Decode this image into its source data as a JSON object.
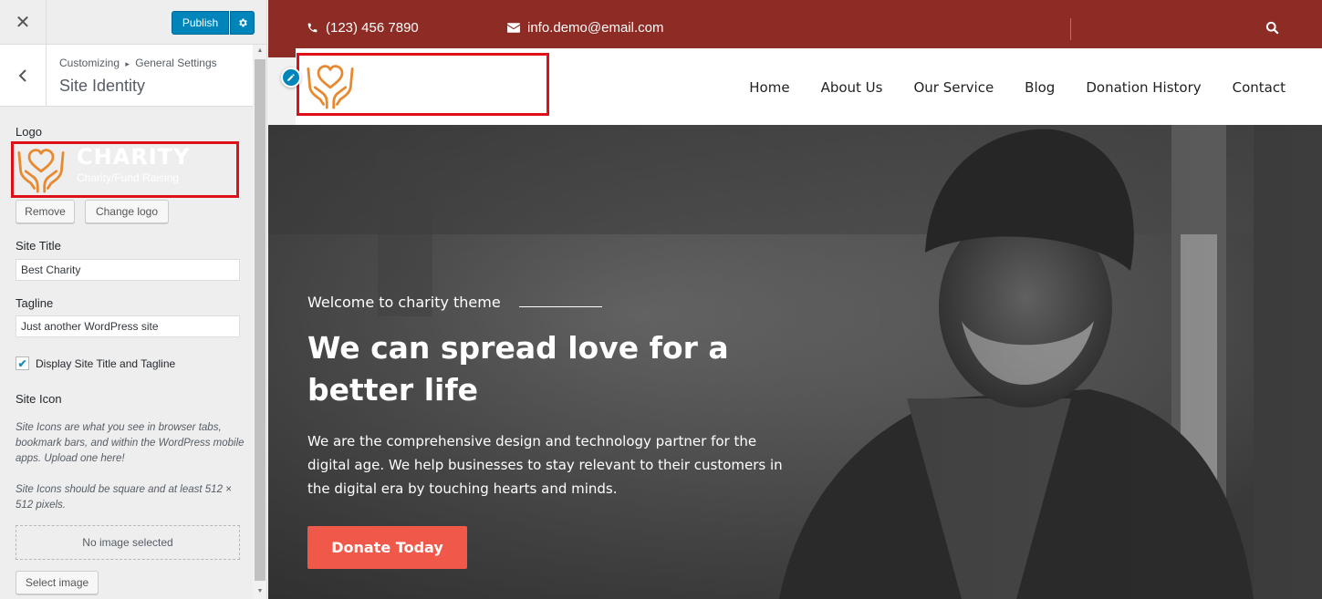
{
  "customizer": {
    "close_icon": "close-icon",
    "publish_label": "Publish",
    "breadcrumb_root": "Customizing",
    "breadcrumb_sep": "▸",
    "breadcrumb_section": "General Settings",
    "section_title": "Site Identity",
    "logo_label": "Logo",
    "logo_name": "CHARITY",
    "logo_tagline": "Charity/Fund Raising",
    "remove_label": "Remove",
    "change_logo_label": "Change logo",
    "site_title_label": "Site Title",
    "site_title_value": "Best Charity",
    "tagline_label": "Tagline",
    "tagline_value": "Just another WordPress site",
    "display_checkbox_label": "Display Site Title and Tagline",
    "display_checkbox_checked": true,
    "site_icon_label": "Site Icon",
    "site_icon_desc_1": "Site Icons are what you see in browser tabs, bookmark bars, and within the WordPress mobile apps. Upload one here!",
    "site_icon_desc_2": "Site Icons should be square and at least 512 × 512 pixels.",
    "no_image_label": "No image selected",
    "select_image_label": "Select image"
  },
  "preview": {
    "phone": "(123) 456 7890",
    "email": "info.demo@email.com",
    "nav": [
      "Home",
      "About Us",
      "Our Service",
      "Blog",
      "Donation History",
      "Contact"
    ],
    "hero_kicker": "Welcome to charity theme",
    "hero_heading": "We can spread love for a better life",
    "hero_text": "We are the comprehensive design and technology partner for the digital age. We help businesses to stay relevant to their customers in the digital era by touching hearts and minds.",
    "donate_label": "Donate Today"
  },
  "colors": {
    "accent_blue": "#0085ba",
    "topbar_red": "#8c2c24",
    "donate_orange": "#f0594a",
    "highlight_red": "#e0101a",
    "logo_orange": "#e8892f"
  }
}
